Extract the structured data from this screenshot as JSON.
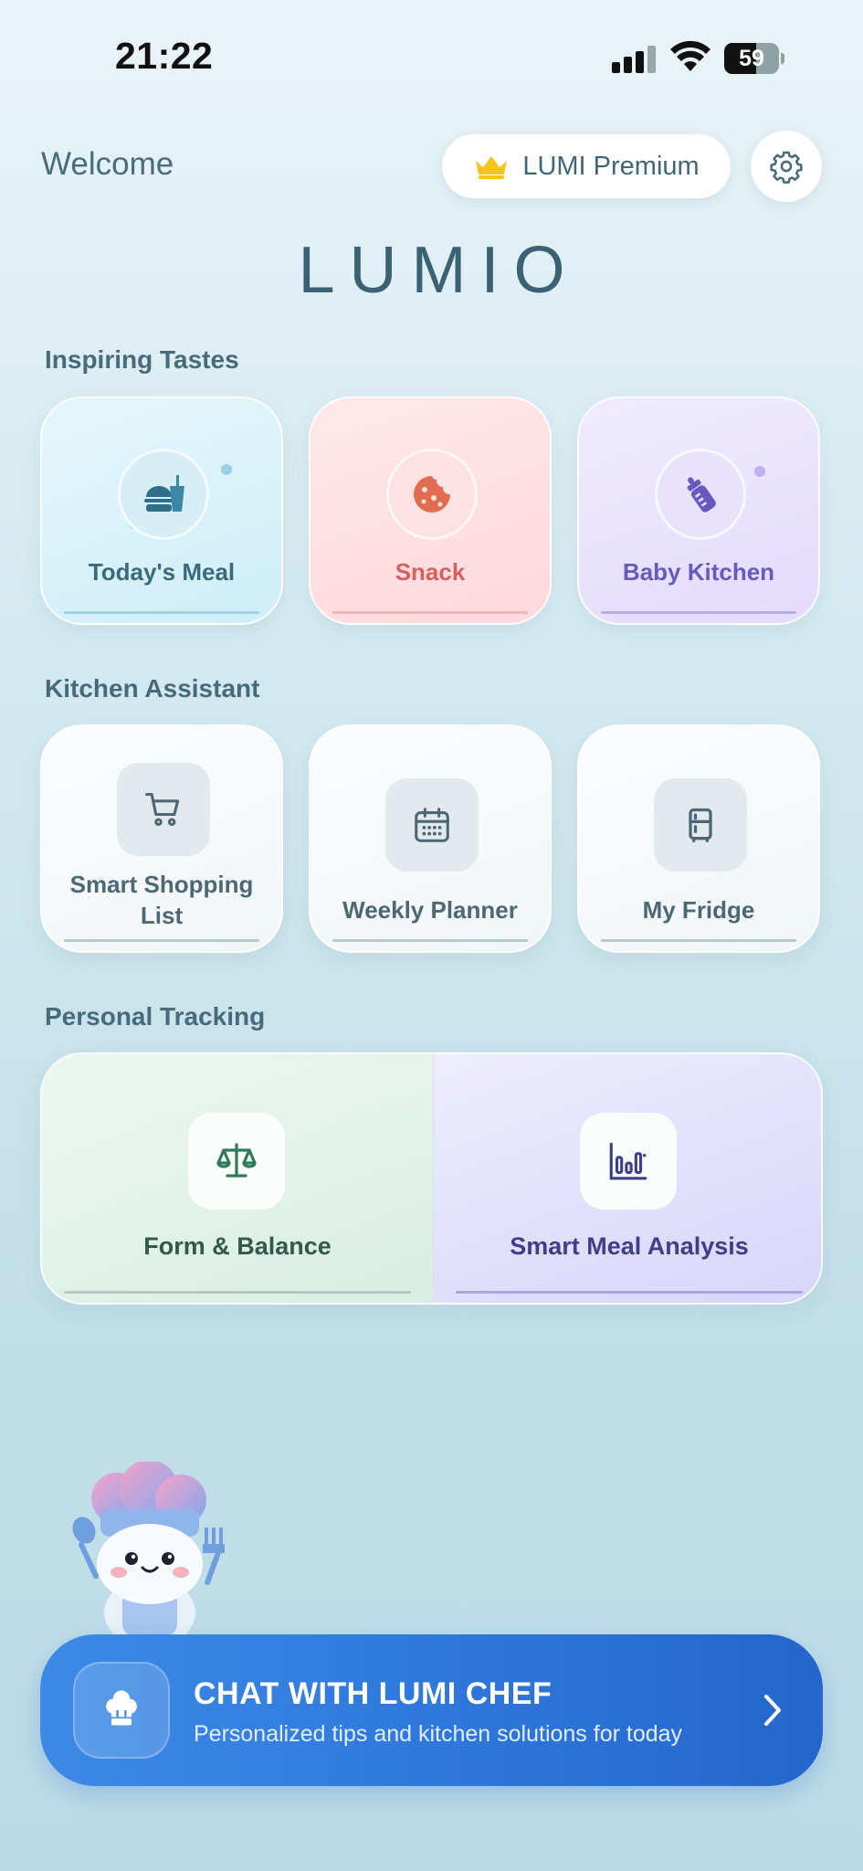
{
  "status_bar": {
    "time": "21:22",
    "battery": "59",
    "battery_level": 0.59
  },
  "header": {
    "welcome": "Welcome",
    "premium_label": "LUMI Premium",
    "logo": "LUMIO"
  },
  "sections": {
    "inspiring": "Inspiring Tastes",
    "assistant": "Kitchen Assistant",
    "tracking": "Personal Tracking"
  },
  "inspiring_cards": [
    {
      "label": "Today's Meal",
      "icon": "meal-icon",
      "accent": "#3b6a7e"
    },
    {
      "label": "Snack",
      "icon": "cookie-icon",
      "accent": "#d85f5e"
    },
    {
      "label": "Baby Kitchen",
      "icon": "baby-bottle-icon",
      "accent": "#6a58c0"
    }
  ],
  "assistant_cards": [
    {
      "label": "Smart Shopping List",
      "icon": "cart-icon"
    },
    {
      "label": "Weekly Planner",
      "icon": "calendar-icon"
    },
    {
      "label": "My Fridge",
      "icon": "fridge-icon"
    }
  ],
  "tracking_cards": [
    {
      "label": "Form & Balance",
      "icon": "scale-icon",
      "accent": "#2f7a5a"
    },
    {
      "label": "Smart Meal Analysis",
      "icon": "bar-chart-icon",
      "accent": "#3e3f8a"
    }
  ],
  "chat": {
    "title": "CHAT WITH LUMI CHEF",
    "subtitle": "Personalized tips and kitchen solutions for today",
    "icon": "chef-hat-icon"
  }
}
